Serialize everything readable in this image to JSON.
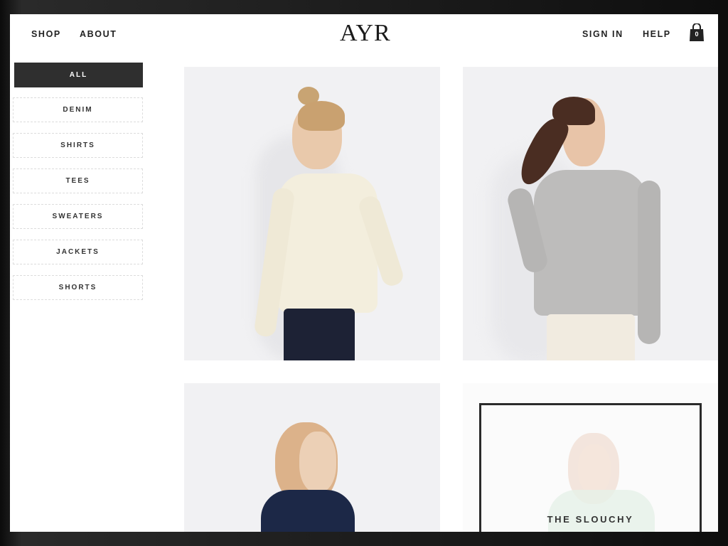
{
  "header": {
    "nav_left": [
      "SHOP",
      "ABOUT"
    ],
    "logo": "AYR",
    "sign_in": "SIGN IN",
    "help": "HELP",
    "cart_count": "0",
    "cart_icon": "shopping-bag-icon"
  },
  "sidebar": {
    "categories": [
      {
        "label": "ALL",
        "active": true
      },
      {
        "label": "DENIM",
        "active": false
      },
      {
        "label": "SHIRTS",
        "active": false
      },
      {
        "label": "TEES",
        "active": false
      },
      {
        "label": "SWEATERS",
        "active": false
      },
      {
        "label": "JACKETS",
        "active": false
      },
      {
        "label": "SHORTS",
        "active": false
      }
    ]
  },
  "products": {
    "promo_label": "THE SLOUCHY"
  },
  "colors": {
    "active_tab": "#2f2f2f",
    "tile_bg": "#f1f1f3",
    "text": "#222222"
  }
}
